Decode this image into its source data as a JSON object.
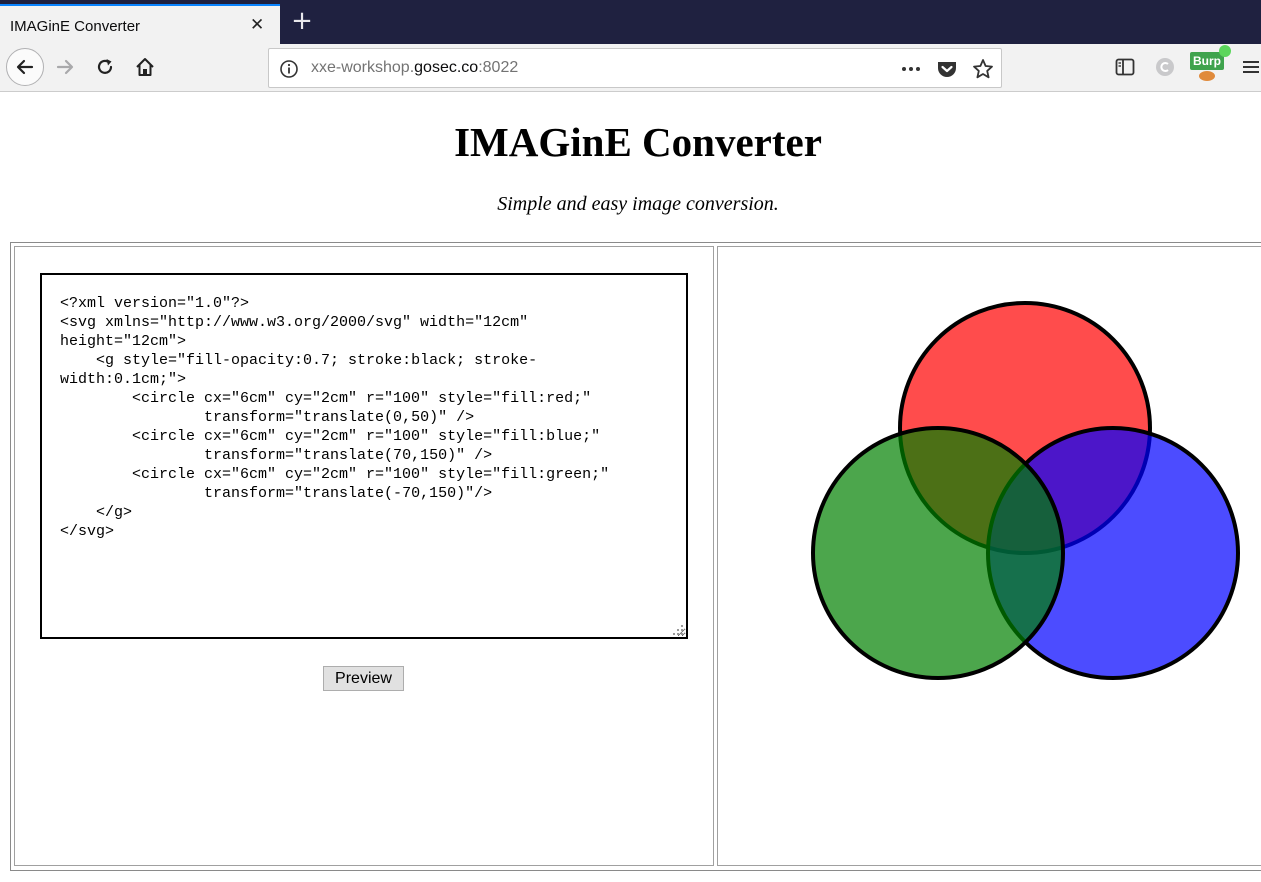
{
  "browser": {
    "tab_title": "IMAGinE Converter",
    "url_host_prefix": "xxe-workshop.",
    "url_host_domain": "gosec.co",
    "url_port": ":8022",
    "burp_label": "Burp",
    "icons": [
      "close-icon",
      "plus-icon",
      "back-icon",
      "forward-icon",
      "reload-icon",
      "home-icon",
      "info-icon",
      "more-icon",
      "pocket-icon",
      "star-icon",
      "sidebar-icon",
      "extension-icon",
      "menu-icon"
    ]
  },
  "page": {
    "title": "IMAGinE Converter",
    "subtitle": "Simple and easy image conversion."
  },
  "editor": {
    "content": "<?xml version=\"1.0\"?>\n<svg xmlns=\"http://www.w3.org/2000/svg\" width=\"12cm\"\nheight=\"12cm\">\n    <g style=\"fill-opacity:0.7; stroke:black; stroke-\nwidth:0.1cm;\">\n        <circle cx=\"6cm\" cy=\"2cm\" r=\"100\" style=\"fill:red;\"\n                transform=\"translate(0,50)\" />\n        <circle cx=\"6cm\" cy=\"2cm\" r=\"100\" style=\"fill:blue;\"\n                transform=\"translate(70,150)\" />\n        <circle cx=\"6cm\" cy=\"2cm\" r=\"100\" style=\"fill:green;\"\n                transform=\"translate(-70,150)\"/>\n    </g>\n</svg>"
  },
  "actions": {
    "preview_label": "Preview"
  },
  "preview": {
    "circles": [
      {
        "name": "red-circle",
        "fill": "#ff0000"
      },
      {
        "name": "blue-circle",
        "fill": "#0000ff"
      },
      {
        "name": "green-circle",
        "fill": "#008000"
      }
    ],
    "fill_opacity": 0.7,
    "stroke": "#000000"
  },
  "colors": {
    "tabbar_bg": "#1f2140",
    "tab_accent": "#0a84ff",
    "toolbar_bg": "#f2f2f2",
    "burp_green": "#3fa34d"
  }
}
